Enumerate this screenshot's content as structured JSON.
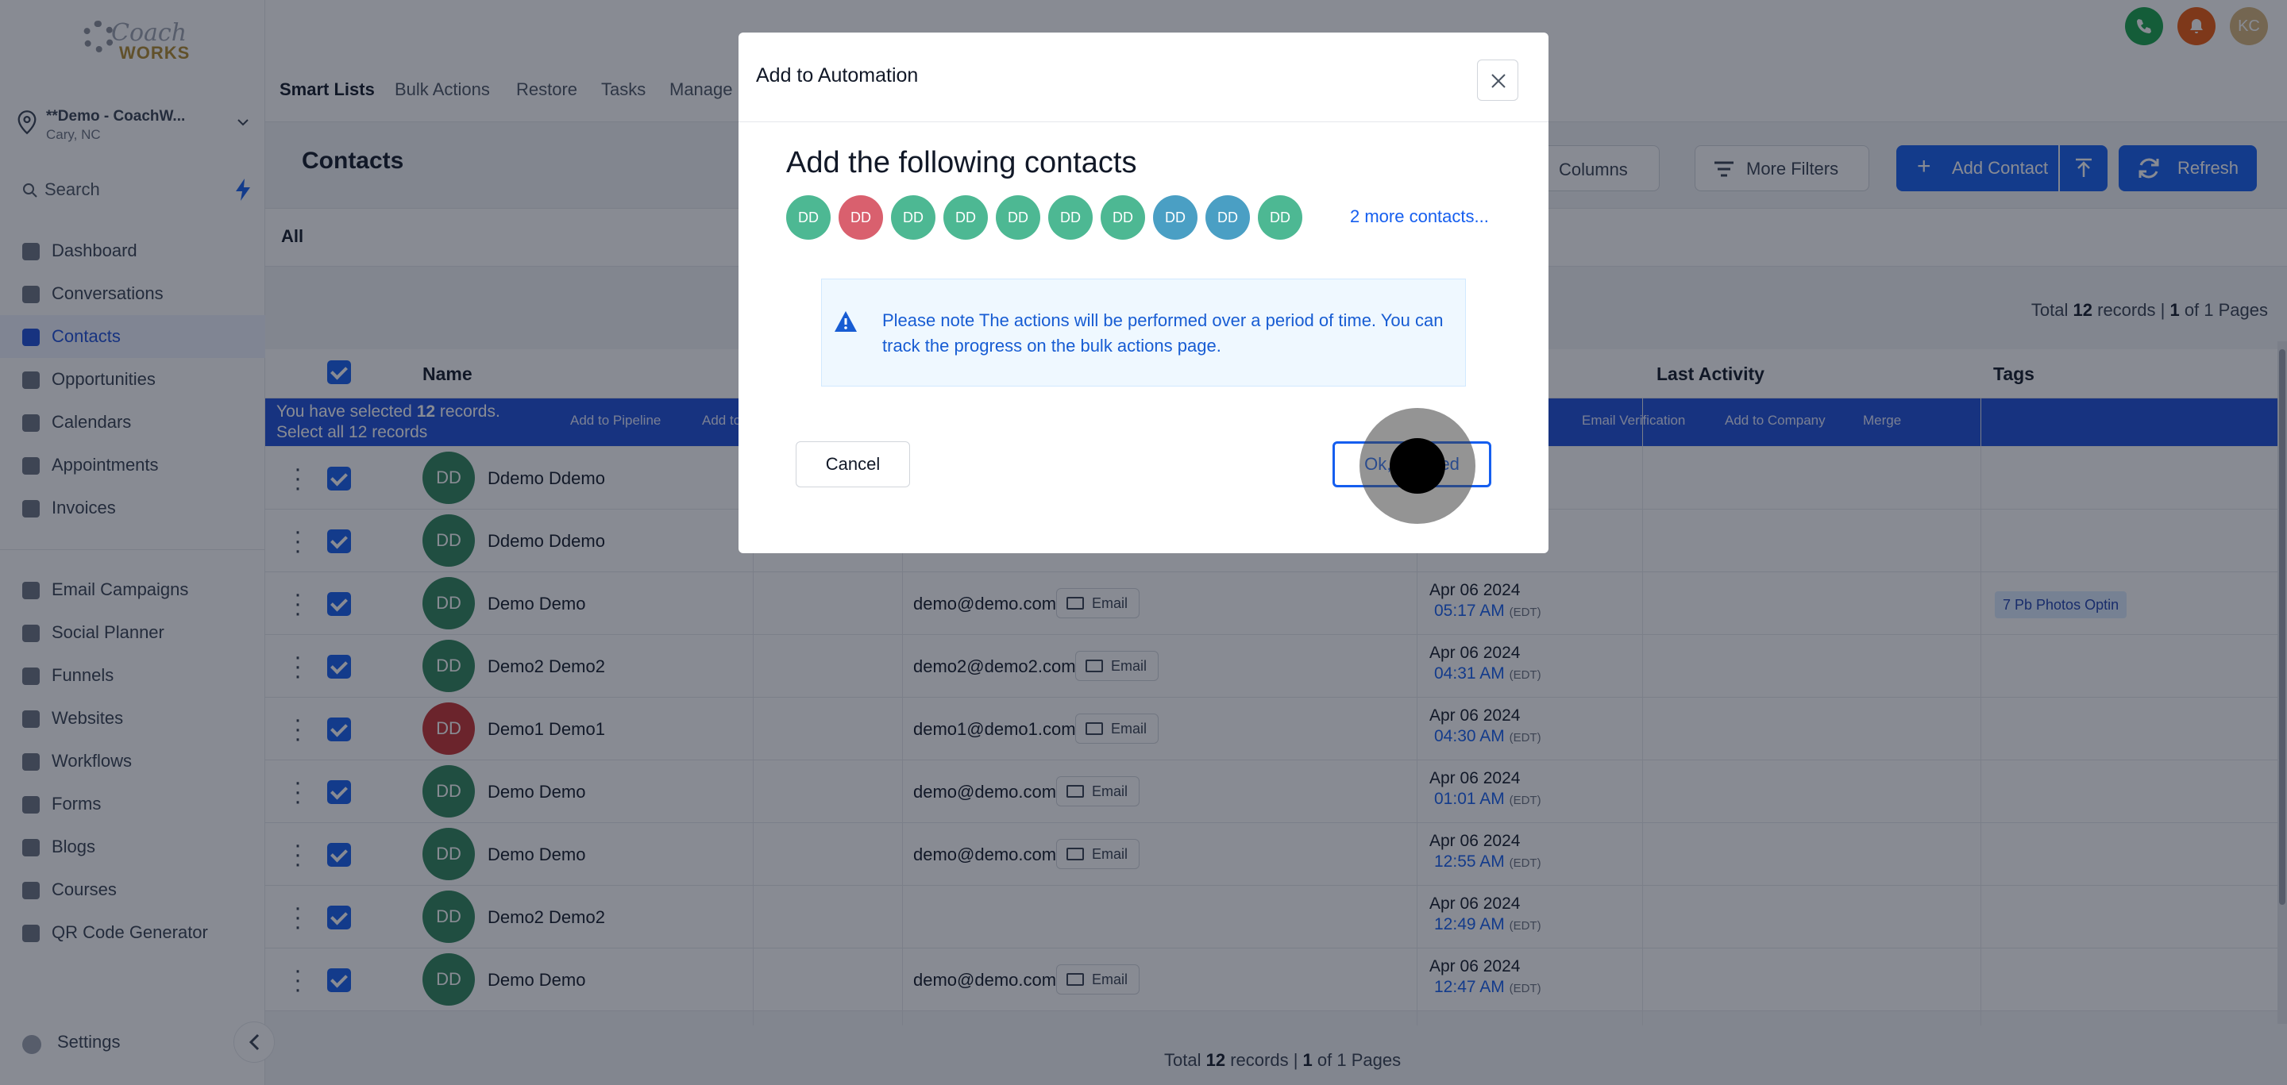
{
  "topbar": {
    "avatar_initials": "KC"
  },
  "brand": {
    "line1": "Coach",
    "line2": "WORKS"
  },
  "location": {
    "name": "**Demo - CoachW...",
    "city": "Cary, NC"
  },
  "search": {
    "label": "Search"
  },
  "nav": {
    "items": [
      {
        "label": "Dashboard",
        "icon": "dashboard-icon"
      },
      {
        "label": "Conversations",
        "icon": "chat-icon"
      },
      {
        "label": "Contacts",
        "icon": "user-icon",
        "active": true
      },
      {
        "label": "Opportunities",
        "icon": "filter-icon"
      },
      {
        "label": "Calendars",
        "icon": "calendar-icon"
      },
      {
        "label": "Appointments",
        "icon": "list-icon"
      },
      {
        "label": "Invoices",
        "icon": "invoice-icon"
      }
    ],
    "items2": [
      {
        "label": "Email Campaigns",
        "icon": "send-icon"
      },
      {
        "label": "Social Planner",
        "icon": "grid-icon"
      },
      {
        "label": "Funnels",
        "icon": "funnel-icon"
      },
      {
        "label": "Websites",
        "icon": "monitor-icon"
      },
      {
        "label": "Workflows",
        "icon": "workflow-icon"
      },
      {
        "label": "Forms",
        "icon": "form-icon"
      },
      {
        "label": "Blogs",
        "icon": "blog-icon"
      },
      {
        "label": "Courses",
        "icon": "book-icon"
      },
      {
        "label": "QR Code Generator",
        "icon": "qr-icon"
      }
    ],
    "settings": "Settings"
  },
  "subnav": {
    "tabs": [
      "Smart Lists",
      "Bulk Actions",
      "Restore",
      "Tasks",
      "Manage"
    ]
  },
  "page": {
    "title": "Contacts",
    "columns_label": "Columns",
    "more_filters_label": "More Filters",
    "add_contact_label": "Add Contact",
    "refresh_label": "Refresh",
    "view_all": "All"
  },
  "records": {
    "prefix": "Total",
    "count": "12",
    "middle": "records |",
    "page": "1",
    "suffix": "of 1 Pages"
  },
  "table": {
    "headers": {
      "name": "Name",
      "last_activity": "Last Activity",
      "tags": "Tags"
    },
    "bulk": {
      "selected_prefix": "You have selected",
      "selected_count": "12",
      "selected_suffix": "records.",
      "select_all": "Select all 12 records",
      "actions": [
        "Add to Pipeline",
        "Add to",
        "Email Verification",
        "Add to Company",
        "Merge"
      ]
    },
    "email_btn": "Email",
    "rows": [
      {
        "initials": "DD",
        "name": "Ddemo Ddemo",
        "email": "",
        "date": "",
        "time": "",
        "tz": "",
        "tag": "",
        "color": "#2f855a"
      },
      {
        "initials": "DD",
        "name": "Ddemo Ddemo",
        "email": "",
        "date": "",
        "time": "",
        "tz": "",
        "tag": "",
        "color": "#2f855a"
      },
      {
        "initials": "DD",
        "name": "Demo Demo",
        "email": "demo@demo.com",
        "date": "Apr 06 2024",
        "time": "05:17 AM",
        "tz": "(EDT)",
        "tag": "7 Pb Photos Optin",
        "color": "#2f855a"
      },
      {
        "initials": "DD",
        "name": "Demo2 Demo2",
        "email": "demo2@demo2.com",
        "date": "Apr 06 2024",
        "time": "04:31 AM",
        "tz": "(EDT)",
        "tag": "",
        "color": "#2f855a"
      },
      {
        "initials": "DD",
        "name": "Demo1 Demo1",
        "email": "demo1@demo1.com",
        "date": "Apr 06 2024",
        "time": "04:30 AM",
        "tz": "(EDT)",
        "tag": "",
        "color": "#c53030"
      },
      {
        "initials": "DD",
        "name": "Demo Demo",
        "email": "demo@demo.com",
        "date": "Apr 06 2024",
        "time": "01:01 AM",
        "tz": "(EDT)",
        "tag": "",
        "color": "#2f855a"
      },
      {
        "initials": "DD",
        "name": "Demo Demo",
        "email": "demo@demo.com",
        "date": "Apr 06 2024",
        "time": "12:55 AM",
        "tz": "(EDT)",
        "tag": "",
        "color": "#2f855a"
      },
      {
        "initials": "DD",
        "name": "Demo2 Demo2",
        "email": "",
        "date": "Apr 06 2024",
        "time": "12:49 AM",
        "tz": "(EDT)",
        "tag": "",
        "color": "#2f855a"
      },
      {
        "initials": "DD",
        "name": "Demo Demo",
        "email": "demo@demo.com",
        "date": "Apr 06 2024",
        "time": "12:47 AM",
        "tz": "(EDT)",
        "tag": "",
        "color": "#2f855a"
      }
    ]
  },
  "modal": {
    "title": "Add to Automation",
    "heading": "Add the following contacts",
    "chips": [
      {
        "initials": "DD",
        "color": "#4db893"
      },
      {
        "initials": "DD",
        "color": "#d9606e"
      },
      {
        "initials": "DD",
        "color": "#4db893"
      },
      {
        "initials": "DD",
        "color": "#4db893"
      },
      {
        "initials": "DD",
        "color": "#4db893"
      },
      {
        "initials": "DD",
        "color": "#4db893"
      },
      {
        "initials": "DD",
        "color": "#4db893"
      },
      {
        "initials": "DD",
        "color": "#4a9fc4"
      },
      {
        "initials": "DD",
        "color": "#4a9fc4"
      },
      {
        "initials": "DD",
        "color": "#4db893"
      }
    ],
    "more_contacts": "2 more contacts...",
    "note": "Please note The actions will be performed over a period of time. You can track the progress on the bulk actions page.",
    "cancel_label": "Cancel",
    "ok_label": "Ok, proceed"
  },
  "colors": {
    "primary": "#155eef",
    "note_bg": "#eff8ff",
    "note_text": "#175cd3"
  }
}
